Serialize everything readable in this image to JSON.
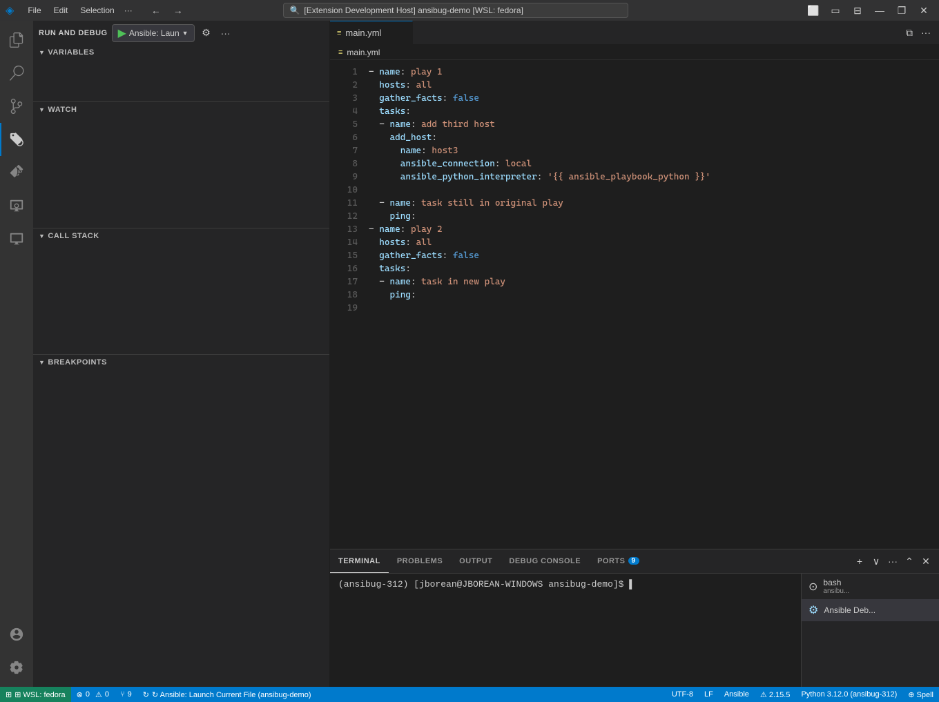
{
  "titlebar": {
    "logo": "◈",
    "menu": [
      "File",
      "Edit",
      "Selection",
      "···"
    ],
    "search": "[Extension Development Host] ansibug-demo [WSL: fedora]",
    "nav_back": "←",
    "nav_forward": "→",
    "controls": [
      "⬜",
      "—",
      "❐",
      "✕"
    ]
  },
  "activity": {
    "items": [
      {
        "name": "explorer",
        "icon": "⎗",
        "active": false
      },
      {
        "name": "search",
        "icon": "🔍",
        "active": false
      },
      {
        "name": "source-control",
        "icon": "⑂",
        "active": false
      },
      {
        "name": "run-debug",
        "icon": "▷",
        "active": true
      },
      {
        "name": "extensions",
        "icon": "⊞",
        "active": false
      },
      {
        "name": "remote-explorer",
        "icon": "⊙",
        "active": false
      },
      {
        "name": "testing",
        "icon": "⊗",
        "active": false
      },
      {
        "name": "accounts",
        "icon": "◎",
        "active": false
      },
      {
        "name": "settings",
        "icon": "⚙",
        "active": false
      }
    ]
  },
  "sidebar": {
    "run_debug_label": "RUN AND DEBUG",
    "config_name": "Ansible: Laun",
    "play_btn": "▶",
    "gear_btn": "⚙",
    "more_btn": "···",
    "sections": {
      "variables": {
        "label": "VARIABLES",
        "expanded": true
      },
      "watch": {
        "label": "WATCH",
        "expanded": true
      },
      "call_stack": {
        "label": "CALL STACK",
        "expanded": true
      },
      "breakpoints": {
        "label": "BREAKPOINTS",
        "expanded": true
      }
    }
  },
  "editor": {
    "tab_label": "main.yml",
    "tab_icon": "≡",
    "breadcrumb": "main.yml",
    "breadcrumb_icon": "≡",
    "lines": [
      {
        "num": "1",
        "content": "- name: play 1"
      },
      {
        "num": "2",
        "content": "  hosts: all"
      },
      {
        "num": "3",
        "content": "  gather_facts: false"
      },
      {
        "num": "4",
        "content": "  tasks:"
      },
      {
        "num": "5",
        "content": "  - name: add third host"
      },
      {
        "num": "6",
        "content": "    add_host:"
      },
      {
        "num": "7",
        "content": "      name: host3"
      },
      {
        "num": "8",
        "content": "      ansible_connection: local"
      },
      {
        "num": "9",
        "content": "      ansible_python_interpreter: '{{ ansible_playbook_python }}'"
      },
      {
        "num": "10",
        "content": ""
      },
      {
        "num": "11",
        "content": "  - name: task still in original play"
      },
      {
        "num": "12",
        "content": "    ping:"
      },
      {
        "num": "13",
        "content": "- name: play 2"
      },
      {
        "num": "14",
        "content": "  hosts: all"
      },
      {
        "num": "15",
        "content": "  gather_facts: false"
      },
      {
        "num": "16",
        "content": "  tasks:"
      },
      {
        "num": "17",
        "content": "  - name: task in new play"
      },
      {
        "num": "18",
        "content": "    ping:"
      },
      {
        "num": "19",
        "content": ""
      }
    ]
  },
  "terminal": {
    "tabs": [
      {
        "label": "TERMINAL",
        "active": true
      },
      {
        "label": "PROBLEMS",
        "active": false
      },
      {
        "label": "OUTPUT",
        "active": false
      },
      {
        "label": "DEBUG CONSOLE",
        "active": false
      },
      {
        "label": "PORTS",
        "badge": "9",
        "active": false
      }
    ],
    "prompt": "(ansibug-312) [jborean@JBOREAN-WINDOWS ansibug-demo]$ ",
    "cursor": "▌",
    "instances": [
      {
        "icon": "⊙",
        "label": "bash",
        "sublabel": "ansibu...",
        "active": false
      },
      {
        "icon": "⚙",
        "label": "Ansible Deb...",
        "active": true
      }
    ]
  },
  "statusbar": {
    "remote": "⊞ WSL: fedora",
    "errors": "⊗ 0  ⚠ 0",
    "ports": "⑂ 9",
    "debug": "↻ Ansible: Launch Current File (ansibug-demo)",
    "encoding": "UTF-8",
    "eol": "LF",
    "language": "Ansible",
    "version": "⚠ 2.15.5",
    "python": "Python 3.12.0 (ansibug-312)",
    "spell": "⊕ Spell"
  }
}
